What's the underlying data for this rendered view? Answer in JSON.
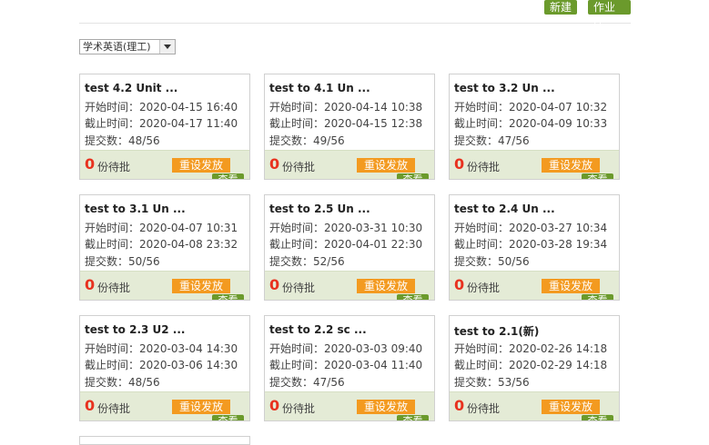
{
  "toolbar": {
    "new_label": "新建",
    "library_label": "作业库"
  },
  "filter": {
    "selected": "学术英语(理工)"
  },
  "labels": {
    "start": "开始时间：",
    "end": "截止时间：",
    "submit": "提交数：",
    "pending": "份待批",
    "reset": "重设发放",
    "view": "查看"
  },
  "cards": [
    {
      "title": "test 4.2 Unit ...",
      "start": "2020-04-15 16:40",
      "end": "2020-04-17 11:40",
      "submitted": "48/56",
      "pending": "0"
    },
    {
      "title": "test to 4.1 Un ...",
      "start": "2020-04-14 10:38",
      "end": "2020-04-15 12:38",
      "submitted": "49/56",
      "pending": "0"
    },
    {
      "title": "test to 3.2 Un ...",
      "start": "2020-04-07 10:32",
      "end": "2020-04-09 10:33",
      "submitted": "47/56",
      "pending": "0"
    },
    {
      "title": "test to 3.1 Un ...",
      "start": "2020-04-07 10:31",
      "end": "2020-04-08 23:32",
      "submitted": "50/56",
      "pending": "0"
    },
    {
      "title": "test to 2.5 Un ...",
      "start": "2020-03-31 10:30",
      "end": "2020-04-01 22:30",
      "submitted": "52/56",
      "pending": "0"
    },
    {
      "title": "test to 2.4 Un ...",
      "start": "2020-03-27 10:34",
      "end": "2020-03-28 19:34",
      "submitted": "50/56",
      "pending": "0"
    },
    {
      "title": "test to 2.3 U2 ...",
      "start": "2020-03-04 14:30",
      "end": "2020-03-06 14:30",
      "submitted": "48/56",
      "pending": "0"
    },
    {
      "title": "test to 2.2 sc ...",
      "start": "2020-03-03 09:40",
      "end": "2020-03-04 11:40",
      "submitted": "47/56",
      "pending": "0"
    },
    {
      "title": "test to 2.1(新)",
      "start": "2020-02-26 14:18",
      "end": "2020-02-29 14:18",
      "submitted": "53/56",
      "pending": "0"
    }
  ]
}
